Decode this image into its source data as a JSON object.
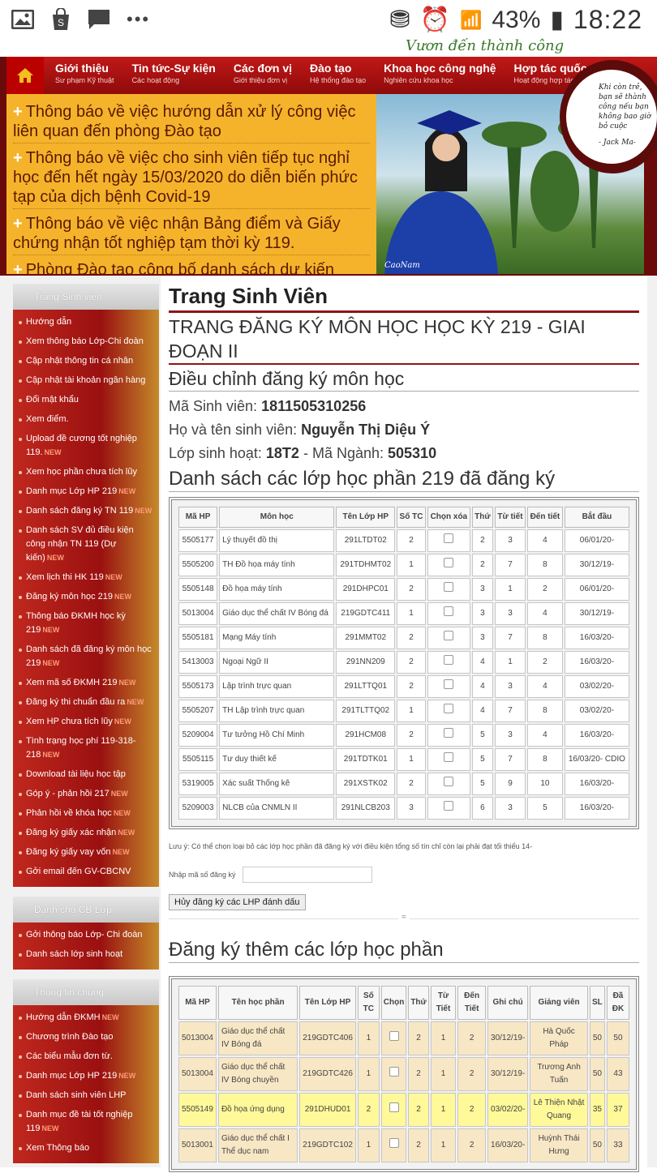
{
  "status": {
    "battery": "43%",
    "time": "18:22"
  },
  "slogan": "Vươn đến thành công",
  "nav": [
    {
      "title": "Giới thiệu",
      "sub": "Sư phạm Kỹ thuật"
    },
    {
      "title": "Tin tức-Sự kiện",
      "sub": "Các hoạt động"
    },
    {
      "title": "Các đơn vị",
      "sub": "Giới thiệu đơn vị"
    },
    {
      "title": "Đào tạo",
      "sub": "Hệ thống đào tạo"
    },
    {
      "title": "Khoa học công nghệ",
      "sub": "Nghiên cứu khoa học"
    },
    {
      "title": "Hợp tác quốc tế",
      "sub": "Hoạt động hợp tác q"
    }
  ],
  "news": [
    "Thông báo về việc hướng dẫn xử lý công việc liên quan đến phòng Đào tạo",
    "Thông báo về việc cho sinh viên tiếp tục nghỉ học đến hết ngày 15/03/2020 do diễn biến phức tạp của dịch bệnh Covid-19",
    "Thông báo về việc nhận Bảng điểm và Giấy chứng nhận tốt nghiệp tạm thời kỳ 119.",
    "Phòng Đào tạo công bố danh sách dự kiến"
  ],
  "quote": {
    "text": "Khi còn trẻ, bạn sẽ thành công nếu bạn không bao giờ bỏ cuộc",
    "author": "- Jack Ma-"
  },
  "photo_caption": "CaoNam",
  "sidebar": [
    {
      "title": "Trang Sinh viên",
      "items": [
        {
          "label": "Hướng dẫn"
        },
        {
          "label": "Xem thông báo Lớp-Chi đoàn"
        },
        {
          "label": "Cập nhật thông tin cá nhân"
        },
        {
          "label": "Cập nhật tài khoản ngân hàng"
        },
        {
          "label": "Đổi mật khẩu"
        },
        {
          "label": "Xem điểm."
        },
        {
          "label": "Upload đề cương tốt nghiệp 119.",
          "hot": "NEW"
        },
        {
          "label": "Xem học phần chưa tích lũy"
        },
        {
          "label": "Danh mục Lớp HP 219",
          "hot": "NEW"
        },
        {
          "label": "Danh sách đăng ký TN 119",
          "hot": "NEW"
        },
        {
          "label": "Danh sách SV đủ điều kiện công nhận TN 119 (Dự kiến)",
          "hot": "NEW"
        },
        {
          "label": "Xem lịch thi HK 119",
          "hot": "NEW"
        },
        {
          "label": "Đăng ký môn học 219",
          "hot": "NEW"
        },
        {
          "label": "Thông báo ĐKMH học kỳ 219",
          "hot": "NEW"
        },
        {
          "label": "Danh sách đã đăng ký môn học 219",
          "hot": "NEW"
        },
        {
          "label": "Xem mã số ĐKMH 219",
          "hot": "NEW"
        },
        {
          "label": "Đăng ký thi chuẩn đầu ra",
          "hot": "NEW"
        },
        {
          "label": "Xem HP chưa tích lũy",
          "hot": "NEW"
        },
        {
          "label": "Tình trạng học phí 119-318-218",
          "hot": "NEW"
        },
        {
          "label": "Download tài liệu học tập"
        },
        {
          "label": "Góp ý - phản hồi 217",
          "hot": "NEW"
        },
        {
          "label": "Phản hồi về khóa học",
          "hot": "NEW"
        },
        {
          "label": "Đăng ký giấy xác nhận",
          "hot": "NEW"
        },
        {
          "label": "Đăng ký giấy vay vốn",
          "hot": "NEW"
        },
        {
          "label": "Gởi email đến GV-CBCNV"
        }
      ]
    },
    {
      "title": "Dành cho CB Lớp",
      "items": [
        {
          "label": "Gởi thông báo Lớp- Chi đoàn"
        },
        {
          "label": "Danh sách lớp sinh hoạt"
        }
      ]
    },
    {
      "title": "Thông tin chung",
      "items": [
        {
          "label": "Hướng dẫn ĐKMH",
          "hot": "NEW"
        },
        {
          "label": "Chương trình Đào tạo"
        },
        {
          "label": "Các biểu mẫu đơn từ."
        },
        {
          "label": "Danh mục Lớp HP 219",
          "hot": "NEW"
        },
        {
          "label": "Danh sách sinh viên LHP"
        },
        {
          "label": "Danh mục đề tài tốt nghiệp 119",
          "hot": "NEW"
        },
        {
          "label": "Xem Thông báo"
        }
      ]
    }
  ],
  "main": {
    "title": "Trang Sinh Viên",
    "subtitle": "TRANG ĐĂNG KÝ MÔN HỌC HỌC KỲ 219 - GIAI ĐOẠN II",
    "section": "Điều chỉnh đăng ký môn học",
    "student_id_label": "Mã Sinh viên:",
    "student_id": "1811505310256",
    "name_label": "Họ và tên sinh viên:",
    "name": "Nguyễn Thị Diệu Ý",
    "class_label": "Lớp sinh hoạt:",
    "class": "18T2",
    "major_label": "- Mã Ngành:",
    "major": "505310",
    "list_title": "Danh sách các lớp học phần 219 đã đăng ký",
    "table1_headers": [
      "Mã HP",
      "Môn học",
      "Tên Lớp HP",
      "Số TC",
      "Chọn xóa",
      "Thứ",
      "Từ tiết",
      "Đến tiết",
      "Bắt đầu"
    ],
    "table1_rows": [
      [
        "5505177",
        "Lý thuyết đồ thị",
        "291LTDT02",
        "2",
        "2",
        "3",
        "4",
        "06/01/20-"
      ],
      [
        "5505200",
        "TH Đồ họa máy tính",
        "291TDHMT02",
        "1",
        "2",
        "7",
        "8",
        "30/12/19-"
      ],
      [
        "5505148",
        "Đồ họa máy tính",
        "291DHPC01",
        "2",
        "3",
        "1",
        "2",
        "06/01/20-"
      ],
      [
        "5013004",
        "Giáo dục thể chất IV Bóng đá",
        "219GDTC411",
        "1",
        "3",
        "3",
        "4",
        "30/12/19-"
      ],
      [
        "5505181",
        "Mạng Máy tính",
        "291MMT02",
        "2",
        "3",
        "7",
        "8",
        "16/03/20-"
      ],
      [
        "5413003",
        "Ngoại Ngữ II",
        "291NN209",
        "2",
        "4",
        "1",
        "2",
        "16/03/20-"
      ],
      [
        "5505173",
        "Lập trình trực quan",
        "291LTTQ01",
        "2",
        "4",
        "3",
        "4",
        "03/02/20-"
      ],
      [
        "5505207",
        "TH Lập trình trực quan",
        "291TLTTQ02",
        "1",
        "4",
        "7",
        "8",
        "03/02/20-"
      ],
      [
        "5209004",
        "Tư tưởng Hồ Chí Minh",
        "291HCM08",
        "2",
        "5",
        "3",
        "4",
        "16/03/20-"
      ],
      [
        "5505115",
        "Tư duy thiết kế",
        "291TDTK01",
        "1",
        "5",
        "7",
        "8",
        "16/03/20- CDIO"
      ],
      [
        "5319005",
        "Xác suất Thống kê",
        "291XSTK02",
        "2",
        "5",
        "9",
        "10",
        "16/03/20-"
      ],
      [
        "5209003",
        "NLCB của CNMLN II",
        "291NLCB203",
        "3",
        "6",
        "3",
        "5",
        "16/03/20-"
      ]
    ],
    "note": "Lưu ý: Có thể chọn loại bỏ các lớp học phần đã đăng ký với điều kiện tổng số tín chỉ còn lại phải đạt tối thiểu 14-",
    "reg_label": "Nhập mã số đăng ký",
    "cancel_button": "Hủy đăng ký các LHP đánh dấu",
    "add_title": "Đăng ký thêm các lớp học phần",
    "table2_headers": [
      "Mã HP",
      "Tên học phần",
      "Tên Lớp HP",
      "Số TC",
      "Chọn",
      "Thứ",
      "Từ Tiết",
      "Đến Tiết",
      "Ghi chú",
      "Giảng viên",
      "SL",
      "Đã ĐK"
    ],
    "table2_rows": [
      {
        "cells": [
          "5013004",
          "Giáo dục thể chất IV Bóng đá",
          "219GDTC406",
          "1",
          "2",
          "1",
          "2",
          "30/12/19-",
          "Hà Quốc Pháp",
          "50",
          "50"
        ],
        "color": "g"
      },
      {
        "cells": [
          "5013004",
          "Giáo dục thể chất IV Bóng chuyền",
          "219GDTC426",
          "1",
          "2",
          "1",
          "2",
          "30/12/19-",
          "Trương Anh Tuấn",
          "50",
          "43"
        ],
        "color": "g"
      },
      {
        "cells": [
          "5505149",
          "Đồ họa ứng dụng",
          "291DHUD01",
          "2",
          "2",
          "1",
          "2",
          "03/02/20-",
          "Lê Thiện Nhật Quang",
          "35",
          "37"
        ],
        "color": "y"
      },
      {
        "cells": [
          "5013001",
          "Giáo dục thể chất I Thể dục nam",
          "219GDTC102",
          "1",
          "2",
          "1",
          "2",
          "16/03/20-",
          "Huỳnh Thái Hưng",
          "50",
          "33"
        ],
        "color": "g"
      }
    ]
  }
}
